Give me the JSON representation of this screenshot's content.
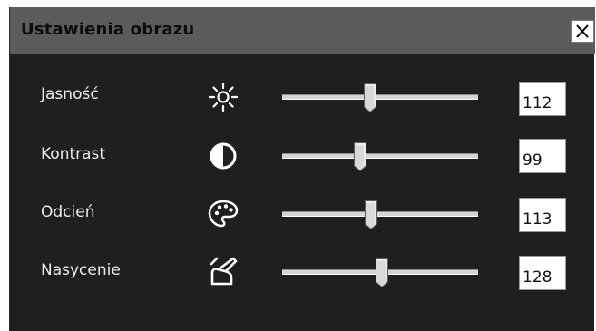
{
  "dialog": {
    "title": "Ustawienia obrazu",
    "close_label": "✕"
  },
  "slider_range": {
    "min": 0,
    "max": 255
  },
  "rows": [
    {
      "label": "Jasność",
      "icon": "brightness-sun-icon",
      "value": "112"
    },
    {
      "label": "Kontrast",
      "icon": "contrast-icon",
      "value": "99"
    },
    {
      "label": "Odcień",
      "icon": "palette-icon",
      "value": "113"
    },
    {
      "label": "Nasycenie",
      "icon": "saturation-brush-icon",
      "value": "128"
    }
  ],
  "colors": {
    "titlebar": "#5b5b5b",
    "panel": "#1f1f1f",
    "label_text": "#ececec"
  }
}
